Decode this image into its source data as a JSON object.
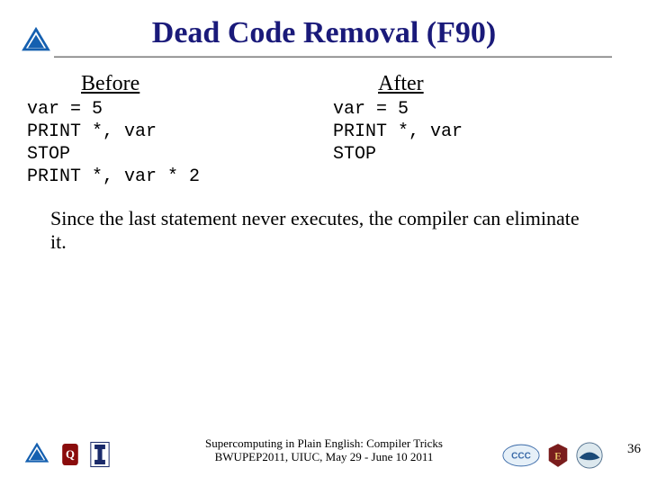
{
  "title": "Dead Code Removal (F90)",
  "before": {
    "heading": "Before",
    "code": "var = 5\nPRINT *, var\nSTOP\nPRINT *, var * 2"
  },
  "after": {
    "heading": "After",
    "code": "var = 5\nPRINT *, var\nSTOP"
  },
  "explanation": "Since the last statement never executes, the compiler can eliminate it.",
  "footer": {
    "line1": "Supercomputing in Plain English: Compiler Tricks",
    "line2": "BWUPEP2011, UIUC, May 29 - June 10 2011"
  },
  "page_number": "36",
  "logos": {
    "header": "tri-logo",
    "footer_left": [
      "tri-logo",
      "ou-logo",
      "uiuc-logo"
    ],
    "footer_right": [
      "ccc-logo",
      "ec-logo",
      "noaa-logo"
    ]
  }
}
